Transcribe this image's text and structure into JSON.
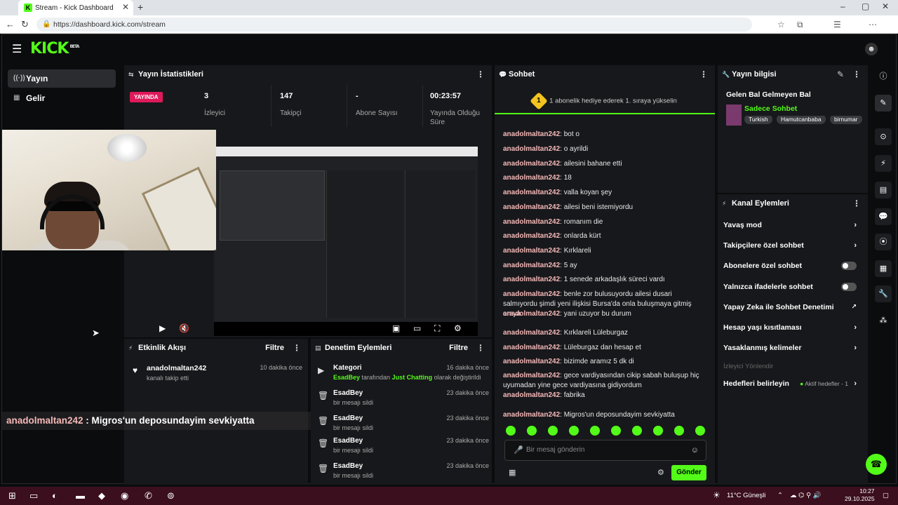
{
  "browser": {
    "tab_title": "Stream - Kick Dashboard",
    "url": "https://dashboard.kick.com/stream"
  },
  "topbar": {
    "logo": "KICK",
    "logo_badge": "BETA"
  },
  "sidebar": {
    "items": [
      {
        "label": "Yayın",
        "icon": "broadcast-icon"
      },
      {
        "label": "Gelir",
        "icon": "revenue-icon"
      }
    ]
  },
  "stats_panel": {
    "title": "Yayın İstatistikleri",
    "live_badge": "YAYINDA",
    "stats": [
      {
        "value": "3",
        "label": "İzleyici"
      },
      {
        "value": "147",
        "label": "Takipçi"
      },
      {
        "value": "-",
        "label": "Abone Sayısı"
      },
      {
        "value": "00:23:57",
        "label": "Yayında Olduğu Süre"
      }
    ]
  },
  "chat": {
    "title": "Sohbet",
    "banner_num": "1",
    "banner": "1 abonelik hediye ederek 1. sıraya yükselin",
    "messages": [
      {
        "user": "anadolmaltan242",
        "text": "bot o"
      },
      {
        "user": "anadolmaltan242",
        "text": "o ayrildi"
      },
      {
        "user": "anadolmaltan242",
        "text": "ailesini bahane etti"
      },
      {
        "user": "anadolmaltan242",
        "text": "18"
      },
      {
        "user": "anadolmaltan242",
        "text": "valla koyan şey"
      },
      {
        "user": "anadolmaltan242",
        "text": "ailesi beni istemiyordu"
      },
      {
        "user": "anadolmaltan242",
        "text": "romanım die"
      },
      {
        "user": "anadolmaltan242",
        "text": "onlarda kürt"
      },
      {
        "user": "anadolmaltan242",
        "text": "Kırklareli"
      },
      {
        "user": "anadolmaltan242",
        "text": "5 ay"
      },
      {
        "user": "anadolmaltan242",
        "text": "1 senede arkadaşlık süreci vardı"
      },
      {
        "user": "anadolmaltan242",
        "text": "benle zor bulusuyordu ailesi dusari salmıyordu şimdi yeni ilişkisi Bursa'da onla buluşmaya gitmiş oraya"
      },
      {
        "user": "anadolmaltan242",
        "text": "yani uzuyor bu durum"
      },
      {
        "user": "anadolmaltan242",
        "text": "Kırklareli Lüleburgaz"
      },
      {
        "user": "anadolmaltan242",
        "text": "Lüleburgaz dan hesap et"
      },
      {
        "user": "anadolmaltan242",
        "text": "bizimde aramız 5 dk di"
      },
      {
        "user": "anadolmaltan242",
        "text": "gece vardiyasından cikip sabah buluşup hiç uyumadan yine gece vardiyasına gidiyordum"
      },
      {
        "user": "anadolmaltan242",
        "text": "fabrika"
      },
      {
        "user": "anadolmaltan242",
        "text": "Migros'un deposundayim sevkiyatta"
      }
    ],
    "input_placeholder": "Bir mesaj gönderin",
    "send_label": "Gönder"
  },
  "stream_info": {
    "title": "Yayın bilgisi",
    "stream_title": "Gelen Bal Gelmeyen Bal",
    "category": "Sadece Sohbet",
    "tags": [
      "Turkish",
      "Hamutcanbaba",
      "birnumar"
    ]
  },
  "channel_actions": {
    "title": "Kanal Eylemleri",
    "items": [
      {
        "label": "Yavaş mod",
        "control": "chevron"
      },
      {
        "label": "Takipçilere özel sohbet",
        "control": "chevron"
      },
      {
        "label": "Abonelere özel sohbet",
        "control": "toggle"
      },
      {
        "label": "Yalnızca ifadelerle sohbet",
        "control": "toggle"
      },
      {
        "label": "Yapay Zeka ile Sohbet Denetimi",
        "control": "external"
      },
      {
        "label": "Hesap yaşı kısıtlaması",
        "control": "chevron"
      },
      {
        "label": "Yasaklanmış kelimeler",
        "control": "chevron"
      }
    ],
    "section_label": "İzleyici Yönlendir",
    "goals_label": "Hedefleri belirleyin",
    "goals_status": "Aktif hedefler - 1"
  },
  "activity_feed": {
    "title": "Etkinlik Akışı",
    "filter_label": "Filtre",
    "items": [
      {
        "user": "anadolmaltan242",
        "action": "kanalı takip etti",
        "time": "10 dakika önce"
      }
    ]
  },
  "mod_actions": {
    "title": "Denetim Eylemleri",
    "filter_label": "Filtre",
    "items": [
      {
        "name": "Kategori",
        "detail_user": "EsadBey",
        "detail_mid": " tarafından ",
        "detail_cat": "Just Chatting",
        "detail_end": " olarak değiştirildi",
        "time": "16 dakika önce",
        "icon": "category-icon"
      },
      {
        "name": "EsadBey",
        "detail": "bir mesajı sildi",
        "time": "23 dakika önce",
        "icon": "trash-icon"
      },
      {
        "name": "EsadBey",
        "detail": "bir mesajı sildi",
        "time": "23 dakika önce",
        "icon": "trash-icon"
      },
      {
        "name": "EsadBey",
        "detail": "bir mesajı sildi",
        "time": "23 dakika önce",
        "icon": "trash-icon"
      },
      {
        "name": "EsadBey",
        "detail": "bir mesajı sildi",
        "time": "23 dakika önce",
        "icon": "trash-icon"
      }
    ]
  },
  "overlay": {
    "user": "anadolmaltan242",
    "text": " : Migros'un deposundayim sevkiyatta"
  },
  "taskbar": {
    "weather": "11°C Güneşli",
    "time": "10:27",
    "date": "29.10.2025"
  },
  "colors": {
    "brand": "#53fc18",
    "live": "#e0195b",
    "username": "#f6b9b9"
  }
}
